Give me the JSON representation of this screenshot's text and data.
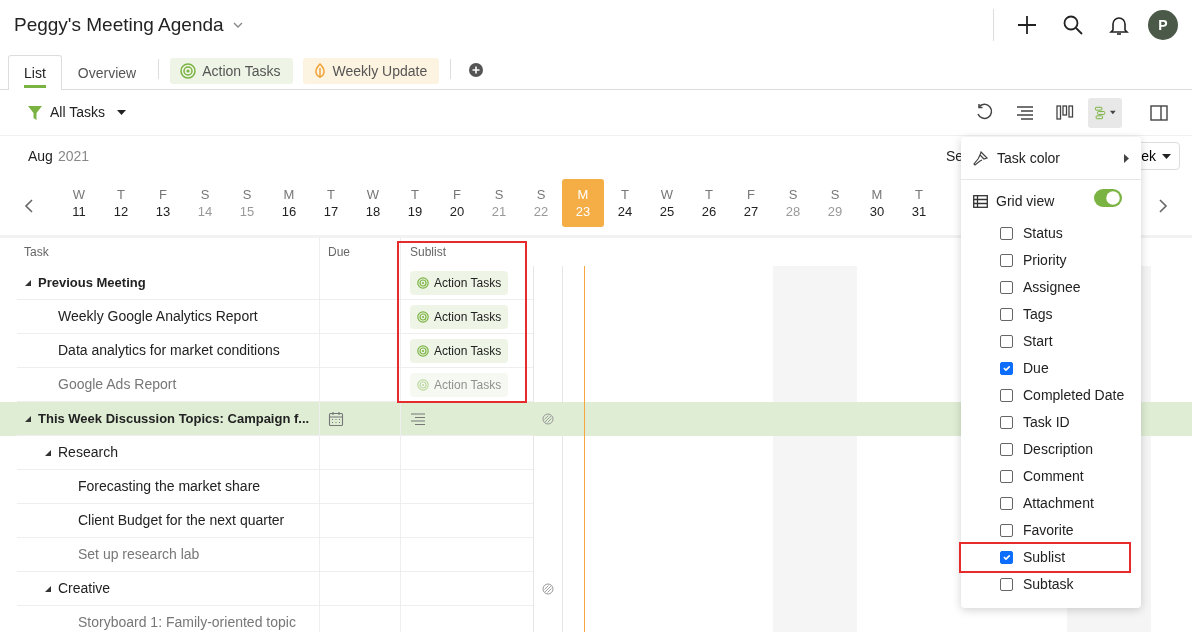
{
  "header": {
    "title": "Peggy's Meeting Agenda",
    "avatar": "P"
  },
  "tabs": [
    {
      "label": "List",
      "kind": "plain",
      "selected": true
    },
    {
      "label": "Overview",
      "kind": "plain",
      "selected": false
    },
    {
      "label": "Action Tasks",
      "kind": "target",
      "selected": false
    },
    {
      "label": "Weekly Update",
      "kind": "leaf",
      "selected": false
    }
  ],
  "filter": {
    "label": "All Tasks"
  },
  "toolbar": [
    {
      "kind": "refresh",
      "selected": false
    },
    {
      "kind": "lines",
      "selected": false
    },
    {
      "kind": "board",
      "selected": false
    },
    {
      "kind": "gantt",
      "selected": true
    },
    {
      "kind": "panel",
      "selected": false
    }
  ],
  "calendar": {
    "month": "Aug",
    "year": "2021",
    "week_label": "Se",
    "week_value": "ek",
    "days": [
      {
        "dow": "W",
        "date": "11",
        "weekend": false,
        "selected": false
      },
      {
        "dow": "T",
        "date": "12",
        "weekend": false,
        "selected": false
      },
      {
        "dow": "F",
        "date": "13",
        "weekend": false,
        "selected": false
      },
      {
        "dow": "S",
        "date": "14",
        "weekend": true,
        "selected": false
      },
      {
        "dow": "S",
        "date": "15",
        "weekend": true,
        "selected": false
      },
      {
        "dow": "M",
        "date": "16",
        "weekend": false,
        "selected": false
      },
      {
        "dow": "T",
        "date": "17",
        "weekend": false,
        "selected": false
      },
      {
        "dow": "W",
        "date": "18",
        "weekend": false,
        "selected": false
      },
      {
        "dow": "T",
        "date": "19",
        "weekend": false,
        "selected": false
      },
      {
        "dow": "F",
        "date": "20",
        "weekend": false,
        "selected": false
      },
      {
        "dow": "S",
        "date": "21",
        "weekend": true,
        "selected": false
      },
      {
        "dow": "S",
        "date": "22",
        "weekend": true,
        "selected": false
      },
      {
        "dow": "M",
        "date": "23",
        "weekend": false,
        "selected": true
      },
      {
        "dow": "T",
        "date": "24",
        "weekend": false,
        "selected": false
      },
      {
        "dow": "W",
        "date": "25",
        "weekend": false,
        "selected": false
      },
      {
        "dow": "T",
        "date": "26",
        "weekend": false,
        "selected": false
      },
      {
        "dow": "F",
        "date": "27",
        "weekend": false,
        "selected": false
      },
      {
        "dow": "S",
        "date": "28",
        "weekend": true,
        "selected": false
      },
      {
        "dow": "S",
        "date": "29",
        "weekend": true,
        "selected": false
      },
      {
        "dow": "M",
        "date": "30",
        "weekend": false,
        "selected": false
      },
      {
        "dow": "T",
        "date": "31",
        "weekend": false,
        "selected": false
      }
    ]
  },
  "table": {
    "columns": [
      {
        "label": "Task"
      },
      {
        "label": "Due"
      },
      {
        "label": "Sublist"
      }
    ],
    "rows": [
      {
        "task": "Previous Meeting",
        "expanded": true,
        "completed": false,
        "selected": false,
        "marker": false,
        "sublist": "Action Tasks",
        "sublist_outlined": true,
        "children": [
          {
            "task": "Weekly Google Analytics Report",
            "completed": false,
            "selected": false,
            "marker": false,
            "sublist": "Action Tasks",
            "sublist_outlined": true
          },
          {
            "task": "Data analytics for market conditions",
            "completed": false,
            "selected": false,
            "marker": false,
            "sublist": "Action Tasks",
            "sublist_outlined": true
          },
          {
            "task": "Google Ads Report",
            "completed": true,
            "selected": false,
            "marker": false,
            "sublist": "Action Tasks",
            "sublist_outlined": true
          }
        ]
      },
      {
        "task": "This Week Discussion Topics: Campaign f...",
        "expanded": true,
        "completed": false,
        "selected": true,
        "marker": true,
        "sublist_outlined": false,
        "children": [
          {
            "task": "Research",
            "expanded": true,
            "completed": false,
            "selected": false,
            "marker": false,
            "sublist_outlined": false,
            "children": [
              {
                "task": "Forecasting the market share",
                "completed": false,
                "selected": false,
                "marker": false,
                "sublist_outlined": false
              },
              {
                "task": "Client Budget for the next quarter",
                "completed": false,
                "selected": false,
                "marker": false,
                "sublist_outlined": false
              },
              {
                "task": "Set up research lab",
                "completed": true,
                "selected": false,
                "marker": false,
                "sublist_outlined": false
              }
            ]
          },
          {
            "task": "Creative",
            "expanded": true,
            "completed": false,
            "selected": false,
            "marker": true,
            "sublist_outlined": false,
            "children": [
              {
                "task": "Storyboard 1: Family-oriented topic",
                "completed": true,
                "selected": false,
                "marker": false,
                "sublist_outlined": false
              }
            ]
          }
        ]
      }
    ]
  },
  "menu": {
    "task_color": "Task color",
    "grid_view": {
      "label": "Grid view",
      "on": true
    },
    "fields": [
      {
        "label": "Status",
        "checked": false,
        "outlined": false
      },
      {
        "label": "Priority",
        "checked": false,
        "outlined": false
      },
      {
        "label": "Assignee",
        "checked": false,
        "outlined": false
      },
      {
        "label": "Tags",
        "checked": false,
        "outlined": false
      },
      {
        "label": "Start",
        "checked": false,
        "outlined": false
      },
      {
        "label": "Due",
        "checked": true,
        "outlined": false
      },
      {
        "label": "Completed Date",
        "checked": false,
        "outlined": false
      },
      {
        "label": "Task ID",
        "checked": false,
        "outlined": false
      },
      {
        "label": "Description",
        "checked": false,
        "outlined": false
      },
      {
        "label": "Comment",
        "checked": false,
        "outlined": false
      },
      {
        "label": "Attachment",
        "checked": false,
        "outlined": false
      },
      {
        "label": "Favorite",
        "checked": false,
        "outlined": false
      },
      {
        "label": "Sublist",
        "checked": true,
        "outlined": true
      },
      {
        "label": "Subtask",
        "checked": false,
        "outlined": false
      }
    ]
  }
}
